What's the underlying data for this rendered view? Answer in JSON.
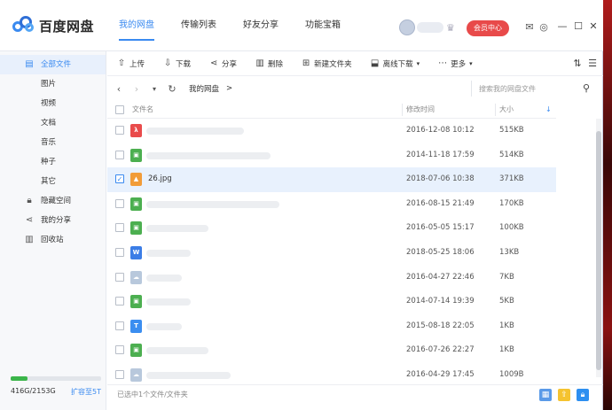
{
  "app": {
    "title": "百度网盘"
  },
  "nav": [
    "我的网盘",
    "传输列表",
    "好友分享",
    "功能宝箱"
  ],
  "header": {
    "vip_label": "会员中心"
  },
  "sidebar": {
    "items": [
      {
        "label": "全部文件",
        "icon": "document-icon"
      },
      {
        "label": "图片"
      },
      {
        "label": "视频"
      },
      {
        "label": "文档"
      },
      {
        "label": "音乐"
      },
      {
        "label": "种子"
      },
      {
        "label": "其它"
      },
      {
        "label": "隐藏空间",
        "icon": "lock-icon"
      },
      {
        "label": "我的分享",
        "icon": "share-icon"
      },
      {
        "label": "回收站",
        "icon": "trash-icon"
      }
    ],
    "quota": "416G/2153G",
    "quota_fraction": 0.19,
    "expand_label": "扩容至5T"
  },
  "toolbar": [
    "上传",
    "下载",
    "分享",
    "删除",
    "新建文件夹",
    "离线下载",
    "更多"
  ],
  "breadcrumb": {
    "path": "我的网盘",
    "sep": ">",
    "search_placeholder": "搜索我的网盘文件"
  },
  "table": {
    "headers": {
      "name": "文件名",
      "date": "修改时间",
      "size": "大小"
    },
    "rows": [
      {
        "icon": "pdf",
        "name": "",
        "date": "2016-12-08 10:12",
        "size": "515KB"
      },
      {
        "icon": "app",
        "name": "",
        "date": "2014-11-18 17:59",
        "size": "514KB"
      },
      {
        "icon": "image",
        "name": "26.jpg",
        "date": "2018-07-06 10:38",
        "size": "371KB",
        "selected": true
      },
      {
        "icon": "app",
        "name": "",
        "date": "2016-08-15 21:49",
        "size": "170KB"
      },
      {
        "icon": "app",
        "name": "",
        "date": "2016-05-05 15:17",
        "size": "100KB"
      },
      {
        "icon": "word",
        "name": "",
        "date": "2018-05-25 18:06",
        "size": "13KB"
      },
      {
        "icon": "cloud",
        "name": "",
        "date": "2016-04-27 22:46",
        "size": "7KB"
      },
      {
        "icon": "app",
        "name": "",
        "date": "2014-07-14 19:39",
        "size": "5KB"
      },
      {
        "icon": "text",
        "name": "",
        "date": "2015-08-18 22:05",
        "size": "1KB"
      },
      {
        "icon": "app",
        "name": "",
        "date": "2016-07-26 22:27",
        "size": "1KB"
      },
      {
        "icon": "cloud",
        "name": "",
        "date": "2016-04-29 17:45",
        "size": "1009B"
      }
    ]
  },
  "footer": {
    "status": "已选中1个文件/文件夹"
  },
  "colors": {
    "accent": "#3a8af0",
    "vip": "#e84a4a",
    "quota": "#3bb54a"
  }
}
